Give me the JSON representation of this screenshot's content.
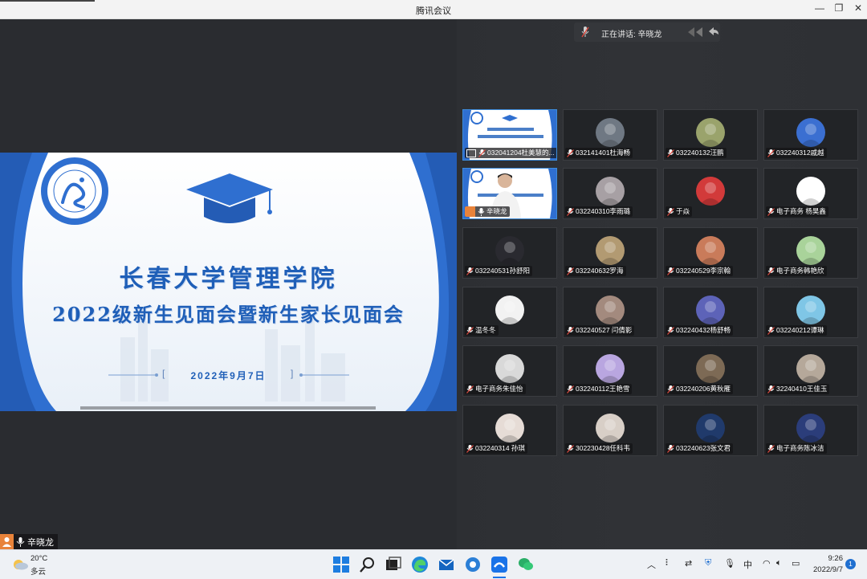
{
  "window": {
    "title": "腾讯会议",
    "minimize": "—",
    "restore": "❐",
    "close": "✕"
  },
  "speaking": {
    "label": "正在讲话: 辛晓龙"
  },
  "slide": {
    "school_name": "长春大学管理学院",
    "subtitle": "2022级新生见面会暨新生家长见面会",
    "date": "2022年9月7日",
    "bracket_left": "[",
    "bracket_right": "]",
    "colors": {
      "blue": "#2f6fd0",
      "text": "#1f5fb8"
    }
  },
  "participants": [
    {
      "name": "032041204杜美慧的...",
      "type": "slide",
      "host": true
    },
    {
      "name": "032141401杜海畅",
      "avatar": "#6f7883"
    },
    {
      "name": "032240132汪鹏",
      "avatar": "#9aa36c"
    },
    {
      "name": "032240312戚越",
      "avatar": "#3b6fd1"
    },
    {
      "name": "辛晓龙",
      "type": "camera",
      "host": true
    },
    {
      "name": "032240310李雨璐",
      "avatar": "#a7a0a4"
    },
    {
      "name": "于焱",
      "avatar": "#d23a3a"
    },
    {
      "name": "电子商务 杨昊鑫",
      "avatar": "#ffffff"
    },
    {
      "name": "032240531孙舒阳",
      "avatar": "#2a2a30"
    },
    {
      "name": "032240632罗海",
      "avatar": "#b29a72"
    },
    {
      "name": "032240529李宗翰",
      "avatar": "#c97b5a"
    },
    {
      "name": "电子商务韩艳欣",
      "avatar": "#a9d39a"
    },
    {
      "name": "温冬冬",
      "avatar": "#f2f2f2"
    },
    {
      "name": "032240527  闫倩影",
      "avatar": "#a38a7e"
    },
    {
      "name": "032240432杨舒畅",
      "avatar": "#5d63b8"
    },
    {
      "name": "032240212谭琳",
      "avatar": "#7fc6e6"
    },
    {
      "name": "电子商务朱佳怡",
      "avatar": "#d9d9d9"
    },
    {
      "name": "032240112王艳雪",
      "avatar": "#b9a6e0"
    },
    {
      "name": "032240206黄秋雁",
      "avatar": "#7d6a55"
    },
    {
      "name": "32240410王佳玉",
      "avatar": "#b5a89a"
    },
    {
      "name": "032240314  孙琪",
      "avatar": "#e6dcd6"
    },
    {
      "name": "302230428任科韦",
      "avatar": "#d8cfc7"
    },
    {
      "name": "032240623张文君",
      "avatar": "#203a6b"
    },
    {
      "name": "电子商务陈冰洁",
      "avatar": "#2b3d7a"
    }
  ],
  "self_label": "辛晓龙",
  "weather": {
    "temp": "20°C",
    "desc": "多云"
  },
  "clock": {
    "time": "9:26",
    "date": "2022/9/7"
  },
  "tray": {
    "ime": "中",
    "notifications": "1"
  },
  "icons": [
    "windows-start-icon",
    "search-icon",
    "task-view-icon",
    "edge-icon",
    "mail-icon",
    "app-icon",
    "tencent-meeting-icon",
    "wechat-icon"
  ]
}
